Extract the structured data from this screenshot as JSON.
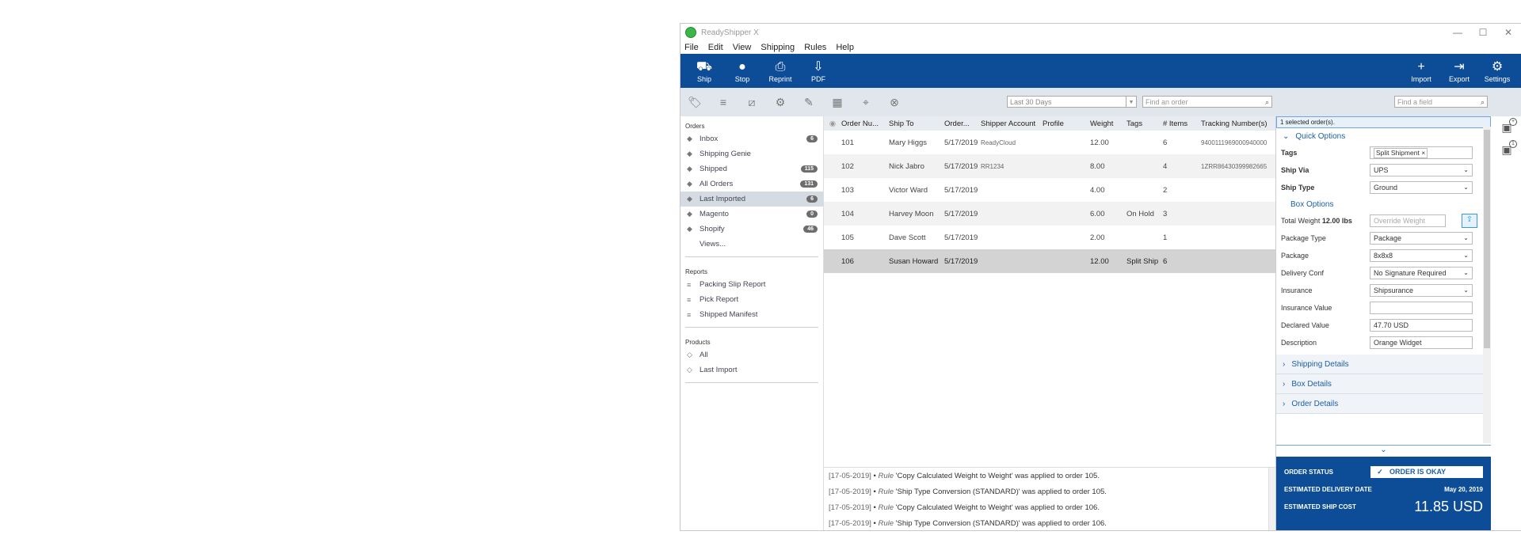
{
  "app": {
    "title": "ReadyShipper X"
  },
  "window_controls": {
    "minimize": "—",
    "maximize": "☐",
    "close": "✕"
  },
  "menu": [
    "File",
    "Edit",
    "View",
    "Shipping",
    "Rules",
    "Help"
  ],
  "toolbar": {
    "left": [
      {
        "label": "Ship",
        "icon": "truck-icon",
        "glyph": "⛟"
      },
      {
        "label": "Stop",
        "icon": "stop-icon",
        "glyph": "●"
      },
      {
        "label": "Reprint",
        "icon": "printer-icon",
        "glyph": "⎙"
      },
      {
        "label": "PDF",
        "icon": "pdf-icon",
        "glyph": "⇩"
      }
    ],
    "right": [
      {
        "label": "Import",
        "icon": "plus-icon",
        "glyph": "+"
      },
      {
        "label": "Export",
        "icon": "export-icon",
        "glyph": "⇥"
      },
      {
        "label": "Settings",
        "icon": "gear-icon",
        "glyph": "⚙"
      }
    ]
  },
  "filter": {
    "date_range": "Last 30 Days",
    "search_placeholder": "Find an order",
    "field_placeholder": "Find a field"
  },
  "sidebar": {
    "orders_title": "Orders",
    "orders": [
      {
        "label": "Inbox",
        "count": "6"
      },
      {
        "label": "Shipping Genie",
        "count": ""
      },
      {
        "label": "Shipped",
        "count": "115"
      },
      {
        "label": "All Orders",
        "count": "131"
      },
      {
        "label": "Last Imported",
        "count": "6"
      },
      {
        "label": "Magento",
        "count": "0"
      },
      {
        "label": "Shopify",
        "count": "46"
      }
    ],
    "views": "Views...",
    "reports_title": "Reports",
    "reports": [
      "Packing Slip Report",
      "Pick Report",
      "Shipped Manifest"
    ],
    "products_title": "Products",
    "products": [
      "All",
      "Last Import"
    ]
  },
  "grid": {
    "headers": [
      "Order Nu...",
      "Ship To",
      "Order...",
      "Shipper Account",
      "Profile",
      "Weight",
      "Tags",
      "# Items",
      "Tracking Number(s)"
    ],
    "rows": [
      {
        "order": "101",
        "ship_to": "Mary Higgs",
        "date": "5/17/2019",
        "account": "ReadyCloud",
        "profile": "",
        "weight": "12.00",
        "tags": "",
        "items": "6",
        "tracking": "9400111969000940000"
      },
      {
        "order": "102",
        "ship_to": "Nick Jabro",
        "date": "5/17/2019",
        "account": "RR1234",
        "profile": "",
        "weight": "8.00",
        "tags": "",
        "items": "4",
        "tracking": "1ZRR86430399982665"
      },
      {
        "order": "103",
        "ship_to": "Victor Ward",
        "date": "5/17/2019",
        "account": "",
        "profile": "",
        "weight": "4.00",
        "tags": "",
        "items": "2",
        "tracking": ""
      },
      {
        "order": "104",
        "ship_to": "Harvey Moon",
        "date": "5/17/2019",
        "account": "",
        "profile": "",
        "weight": "6.00",
        "tags": "On Hold",
        "items": "3",
        "tracking": ""
      },
      {
        "order": "105",
        "ship_to": "Dave Scott",
        "date": "5/17/2019",
        "account": "",
        "profile": "",
        "weight": "2.00",
        "tags": "",
        "items": "1",
        "tracking": ""
      },
      {
        "order": "106",
        "ship_to": "Susan Howard",
        "date": "5/17/2019",
        "account": "",
        "profile": "",
        "weight": "12.00",
        "tags": "Split Ship",
        "items": "6",
        "tracking": ""
      }
    ]
  },
  "log": [
    {
      "ts": "[17-05-2019]",
      "rule": "Rule",
      "text": "'Copy Calculated Weight to Weight' was applied to order 105."
    },
    {
      "ts": "[17-05-2019]",
      "rule": "Rule",
      "text": "'Ship Type Conversion (STANDARD)' was applied to order 105."
    },
    {
      "ts": "[17-05-2019]",
      "rule": "Rule",
      "text": "'Copy Calculated Weight to Weight' was applied to order 106."
    },
    {
      "ts": "[17-05-2019]",
      "rule": "Rule",
      "text": "'Ship Type Conversion (STANDARD)' was applied to order 106."
    }
  ],
  "panel": {
    "selected": "1 selected order(s).",
    "quick_options": "Quick Options",
    "tags_label": "Tags",
    "tag_chip": "Split Shipment",
    "ship_via_label": "Ship Via",
    "ship_via": "UPS",
    "ship_type_label": "Ship Type",
    "ship_type": "Ground",
    "box_options": "Box Options",
    "total_weight_label": "Total Weight",
    "total_weight": "12.00 lbs",
    "override_placeholder": "Override Weight",
    "package_type_label": "Package Type",
    "package_type": "Package",
    "package_label": "Package",
    "package": "8x8x8",
    "delivery_conf_label": "Delivery Conf",
    "delivery_conf": "No Signature Required",
    "insurance_label": "Insurance",
    "insurance": "Shipsurance",
    "insurance_value_label": "Insurance Value",
    "insurance_value": "",
    "declared_value_label": "Declared Value",
    "declared_value": "47.70 USD",
    "description_label": "Description",
    "description": "Orange Widget",
    "shipping_details": "Shipping Details",
    "box_details": "Box Details",
    "order_details": "Order Details"
  },
  "status": {
    "order_status_label": "ORDER STATUS",
    "order_status": "ORDER IS OKAY",
    "delivery_label": "ESTIMATED DELIVERY DATE",
    "delivery_date": "May 20, 2019",
    "cost_label": "ESTIMATED SHIP COST",
    "cost": "11.85 USD"
  },
  "colors": {
    "toolbar_bg": "#0d4c96",
    "accent": "#1c5fa8",
    "logo": "#3cb54a"
  }
}
